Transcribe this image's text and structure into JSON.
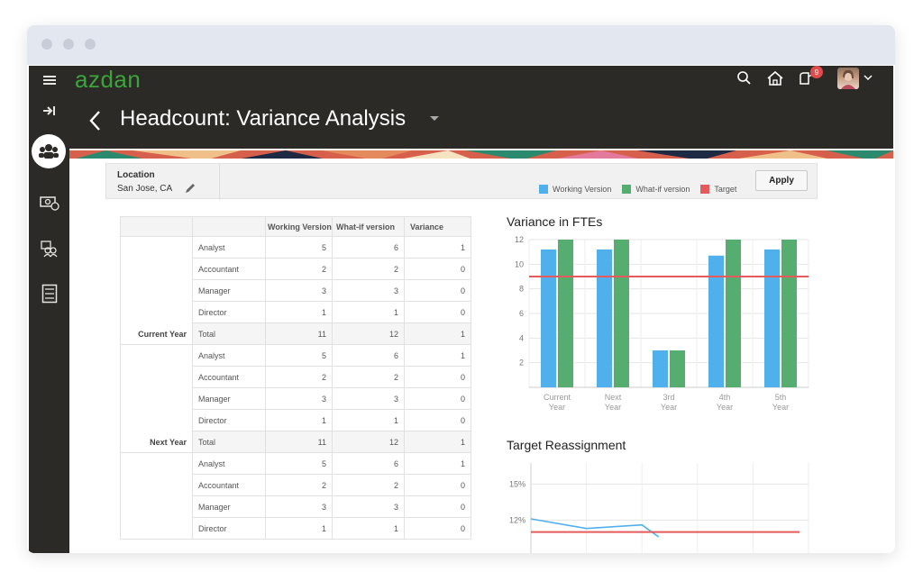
{
  "app": {
    "logo": "azdan",
    "page_title": "Headcount: Variance Analysis",
    "notification_count": "9"
  },
  "sidebar": {
    "icons": [
      "menu-icon",
      "collapse-arrow-icon",
      "team-icon",
      "money-icon",
      "group-icon",
      "checklist-icon"
    ]
  },
  "filter": {
    "location_label": "Location",
    "location_value": "San Jose, CA",
    "apply_label": "Apply"
  },
  "table": {
    "headers": [
      "",
      "",
      "Working Version",
      "What-if version",
      "Variance"
    ],
    "groups": [
      {
        "label": "Current Year",
        "rows": [
          {
            "role": "Analyst",
            "working": "5",
            "whatif": "6",
            "variance": "1"
          },
          {
            "role": "Accountant",
            "working": "2",
            "whatif": "2",
            "variance": "0"
          },
          {
            "role": "Manager",
            "working": "3",
            "whatif": "3",
            "variance": "0"
          },
          {
            "role": "Director",
            "working": "1",
            "whatif": "1",
            "variance": "0"
          },
          {
            "role": "Total",
            "working": "11",
            "whatif": "12",
            "variance": "1"
          }
        ]
      },
      {
        "label": "Next Year",
        "rows": [
          {
            "role": "Analyst",
            "working": "5",
            "whatif": "6",
            "variance": "1"
          },
          {
            "role": "Accountant",
            "working": "2",
            "whatif": "2",
            "variance": "0"
          },
          {
            "role": "Manager",
            "working": "3",
            "whatif": "3",
            "variance": "0"
          },
          {
            "role": "Director",
            "working": "1",
            "whatif": "1",
            "variance": "0"
          },
          {
            "role": "Total",
            "working": "11",
            "whatif": "12",
            "variance": "1"
          }
        ]
      },
      {
        "label": "",
        "rows": [
          {
            "role": "Analyst",
            "working": "5",
            "whatif": "6",
            "variance": "1"
          },
          {
            "role": "Accountant",
            "working": "2",
            "whatif": "2",
            "variance": "0"
          },
          {
            "role": "Manager",
            "working": "3",
            "whatif": "3",
            "variance": "0"
          },
          {
            "role": "Director",
            "working": "1",
            "whatif": "1",
            "variance": "0"
          }
        ]
      }
    ]
  },
  "legend": [
    {
      "name": "Working Version",
      "color": "#4fb0ec"
    },
    {
      "name": "What-if version",
      "color": "#55ad6f"
    },
    {
      "name": "Target",
      "color": "#e55a5a"
    }
  ],
  "chart_data": [
    {
      "type": "bar",
      "title": "Variance in FTEs",
      "categories": [
        "Current Year",
        "Next Year",
        "3rd Year",
        "4th Year",
        "5th Year"
      ],
      "series": [
        {
          "name": "Working Version",
          "values": [
            11.2,
            11.2,
            3,
            10.7,
            11.2
          ],
          "color": "#4fb0ec"
        },
        {
          "name": "What-if version",
          "values": [
            12,
            12,
            3,
            12,
            12
          ],
          "color": "#55ad6f"
        }
      ],
      "target": {
        "name": "Target",
        "value": 9,
        "color": "#e55a5a"
      },
      "yticks": [
        2,
        4,
        6,
        8,
        10,
        12
      ],
      "ylim": [
        0,
        12
      ],
      "grid": true
    },
    {
      "type": "line",
      "title": "Target Reassignment",
      "yticks": [
        "15%",
        "12%"
      ],
      "series": [
        {
          "name": "Working Version",
          "values": [
            12.1,
            11.3,
            11.6,
            10.6
          ],
          "color": "#4fb0ec"
        },
        {
          "name": "Target",
          "values": [
            11.0,
            11.0,
            11.0,
            11.0,
            11.0
          ],
          "color": "#e55a5a"
        }
      ],
      "grid": true
    }
  ]
}
